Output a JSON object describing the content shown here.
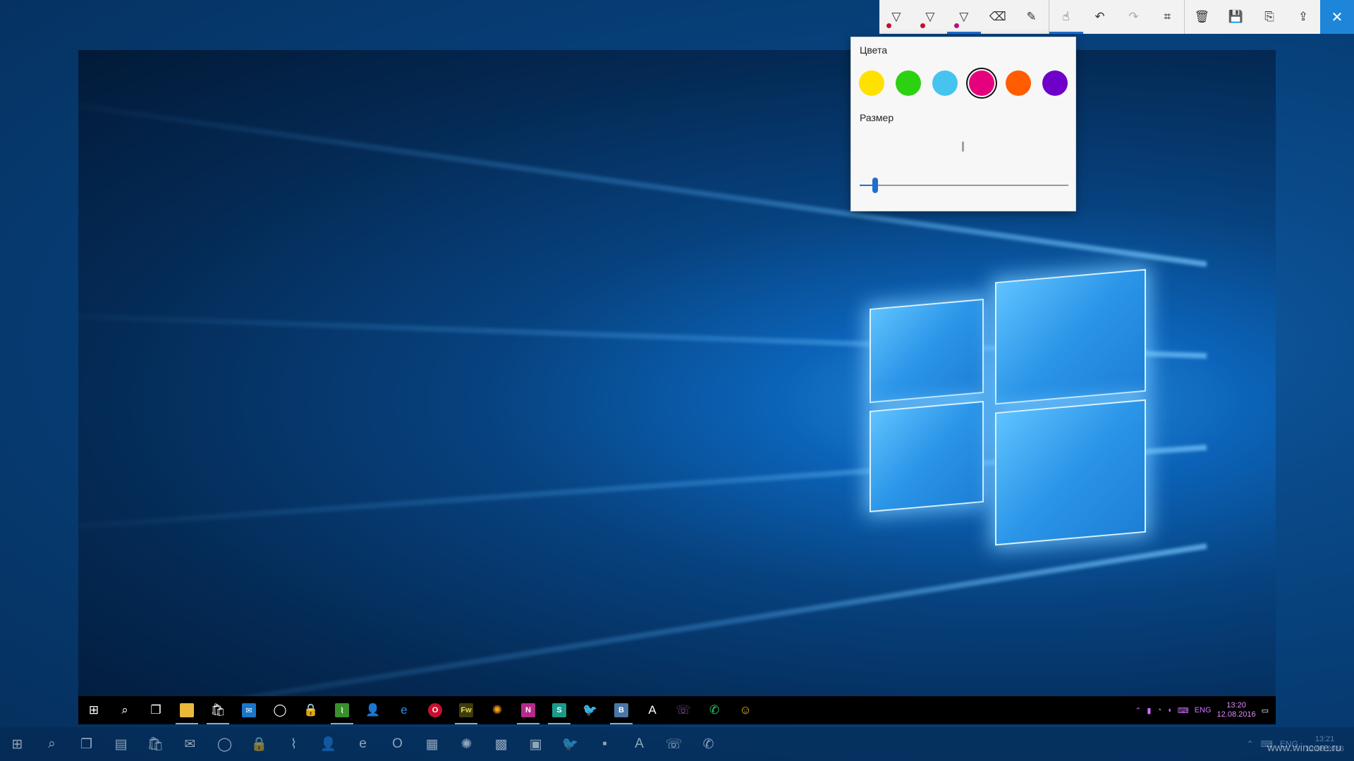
{
  "toolbar": {
    "tools": [
      {
        "name": "ballpoint-pen",
        "glyph": "▽",
        "dot_color": "#c0102a"
      },
      {
        "name": "pencil",
        "glyph": "▽",
        "dot_color": "#c0102a"
      },
      {
        "name": "highlighter",
        "glyph": "▽",
        "dot_color": "#c0107a"
      },
      {
        "name": "eraser",
        "glyph": "⌫"
      },
      {
        "name": "ruler",
        "glyph": "✎"
      },
      {
        "name": "touch-writing",
        "glyph": "☝"
      },
      {
        "name": "undo",
        "glyph": "↶"
      },
      {
        "name": "redo",
        "glyph": "↷"
      },
      {
        "name": "crop",
        "glyph": "⌗"
      },
      {
        "name": "delete",
        "glyph": "🗑"
      },
      {
        "name": "save",
        "glyph": "💾"
      },
      {
        "name": "copy",
        "glyph": "⎘"
      },
      {
        "name": "share",
        "glyph": "⇪"
      }
    ],
    "close_glyph": "✕"
  },
  "flyout": {
    "colors_label": "Цвета",
    "size_label": "Размер",
    "swatches": [
      "#ffe100",
      "#2cd112",
      "#45c4f0",
      "#e5007e",
      "#ff5d00",
      "#6f00c9"
    ],
    "selected_color": "#e5007e",
    "size_value": 0.07
  },
  "inner_taskbar": {
    "clock_time": "13:20",
    "clock_date": "12.08.2016",
    "lang": "ENG"
  },
  "outer_taskbar": {
    "clock_time": "13:21",
    "clock_date": "12.08.2016",
    "lang": "ENG"
  },
  "watermark": "www.wincore.ru"
}
